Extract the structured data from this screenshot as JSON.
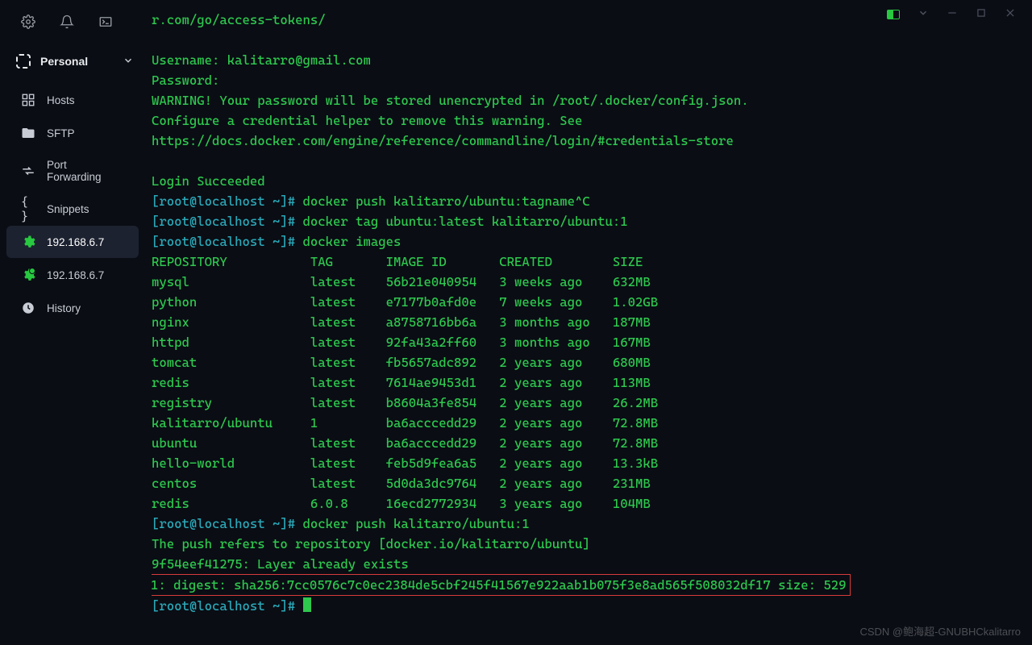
{
  "titlebar": {
    "window_controls": [
      "panel-icon",
      "chevron-down-icon",
      "minimize-icon",
      "maximize-icon",
      "close-icon"
    ]
  },
  "sidebar": {
    "workspace_label": "Personal",
    "items": [
      {
        "label": "Hosts",
        "icon": "grid-icon"
      },
      {
        "label": "SFTP",
        "icon": "folder-icon"
      },
      {
        "label": "Port Forwarding",
        "icon": "arrows-icon"
      },
      {
        "label": "Snippets",
        "icon": "braces-icon"
      },
      {
        "label": "192.168.6.7",
        "icon": "gear-icon",
        "active": true
      },
      {
        "label": "192.168.6.7",
        "icon": "gear-icon",
        "status": "green"
      },
      {
        "label": "History",
        "icon": "clock-icon"
      }
    ]
  },
  "terminal": {
    "url_tail": "r.com/go/access-tokens/",
    "username_label": "Username: ",
    "username": "kalitarro@gmail.com",
    "password_label": "Password:",
    "warning": "WARNING! Your password will be stored unencrypted in /root/.docker/config.json.",
    "configure": "Configure a credential helper to remove this warning. See",
    "docs_url": "https://docs.docker.com/engine/reference/commandline/login/#credentials-store",
    "login_ok": "Login Succeeded",
    "prompt": "[root@localhost ~]# ",
    "cmd_push_cancel": "docker push kalitarro/ubuntu:tagname^C",
    "cmd_tag": "docker tag ubuntu:latest kalitarro/ubuntu:1",
    "cmd_images": "docker images",
    "header": "REPOSITORY           TAG       IMAGE ID       CREATED        SIZE",
    "rows": [
      "mysql                latest    56b21e040954   3 weeks ago    632MB",
      "python               latest    e7177b0afd0e   7 weeks ago    1.02GB",
      "nginx                latest    a8758716bb6a   3 months ago   187MB",
      "httpd                latest    92fa43a2ff60   3 months ago   167MB",
      "tomcat               latest    fb5657adc892   2 years ago    680MB",
      "redis                latest    7614ae9453d1   2 years ago    113MB",
      "registry             latest    b8604a3fe854   2 years ago    26.2MB",
      "kalitarro/ubuntu     1         ba6acccedd29   2 years ago    72.8MB",
      "ubuntu               latest    ba6acccedd29   2 years ago    72.8MB",
      "hello-world          latest    feb5d9fea6a5   2 years ago    13.3kB",
      "centos               latest    5d0da3dc9764   2 years ago    231MB",
      "redis                6.0.8     16ecd2772934   3 years ago    104MB"
    ],
    "cmd_push": "docker push kalitarro/ubuntu:1",
    "push_refers": "The push refers to repository [docker.io/kalitarro/ubuntu]",
    "layer": "9f54eef41275: Layer already exists",
    "digest": "1: digest: sha256:7cc0576c7c0ec2384de5cbf245f41567e922aab1b075f3e8ad565f508032df17 size: 529"
  },
  "watermark": "CSDN @鲍海超-GNUBHCkalitarro"
}
